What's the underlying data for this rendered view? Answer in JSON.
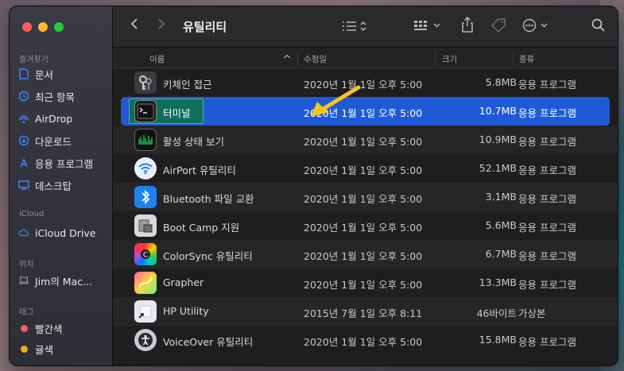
{
  "sidebar": {
    "favorites_label": "즐겨찾기",
    "favorites": [
      {
        "label": "문서",
        "icon": "document-icon"
      },
      {
        "label": "최근 항목",
        "icon": "clock-icon"
      },
      {
        "label": "AirDrop",
        "icon": "airdrop-icon"
      },
      {
        "label": "다운로드",
        "icon": "download-icon"
      },
      {
        "label": "응용 프로그램",
        "icon": "apps-icon"
      },
      {
        "label": "데스크탑",
        "icon": "desktop-icon"
      }
    ],
    "icloud_label": "iCloud",
    "icloud": [
      {
        "label": "iCloud Drive",
        "icon": "cloud-icon"
      }
    ],
    "locations_label": "위치",
    "locations": [
      {
        "label": "Jim의 Mac...",
        "icon": "laptop-icon"
      }
    ],
    "tags_label": "태그",
    "tags": [
      {
        "label": "빨간색",
        "color": "#ff5b5b"
      },
      {
        "label": "귤색",
        "color": "#f5a623"
      }
    ]
  },
  "toolbar": {
    "title": "유틸리티"
  },
  "columns": {
    "name": "이름",
    "date": "수정일",
    "size": "크기",
    "kind": "종류"
  },
  "files": [
    {
      "name": "키체인 접근",
      "date": "2020년 1월 1일 오후 5:00",
      "size": "5.8MB",
      "kind": "응용 프로그램",
      "icon": "keychain-icon"
    },
    {
      "name": "터미널",
      "date": "2020년 1월 1일 오후 5:00",
      "size": "10.7MB",
      "kind": "응용 프로그램",
      "icon": "terminal-icon"
    },
    {
      "name": "활성 상태 보기",
      "date": "2020년 1월 1일 오후 5:00",
      "size": "10.9MB",
      "kind": "응용 프로그램",
      "icon": "activity-monitor-icon"
    },
    {
      "name": "AirPort 유틸리티",
      "date": "2020년 1월 1일 오후 5:00",
      "size": "52.1MB",
      "kind": "응용 프로그램",
      "icon": "wifi-icon"
    },
    {
      "name": "Bluetooth 파일 교환",
      "date": "2020년 1월 1일 오후 5:00",
      "size": "3.1MB",
      "kind": "응용 프로그램",
      "icon": "bluetooth-icon"
    },
    {
      "name": "Boot Camp 지원",
      "date": "2020년 1월 1일 오후 5:00",
      "size": "5.6MB",
      "kind": "응용 프로그램",
      "icon": "bootcamp-icon"
    },
    {
      "name": "ColorSync 유틸리티",
      "date": "2020년 1월 1일 오후 5:00",
      "size": "6.7MB",
      "kind": "응용 프로그램",
      "icon": "colorsync-icon"
    },
    {
      "name": "Grapher",
      "date": "2020년 1월 1일 오후 5:00",
      "size": "13.3MB",
      "kind": "응용 프로그램",
      "icon": "grapher-icon"
    },
    {
      "name": "HP Utility",
      "date": "2015년 7월 1일 오후 8:11",
      "size": "46바이트",
      "kind": "가상본",
      "icon": "alias-icon"
    },
    {
      "name": "VoiceOver 유틸리티",
      "date": "2020년 1월 1일 오후 5:00",
      "size": "15.8MB",
      "kind": "응용 프로그램",
      "icon": "voiceover-icon"
    }
  ],
  "accent_color": "#1f5ad6",
  "annotation_color": "#f5c518"
}
